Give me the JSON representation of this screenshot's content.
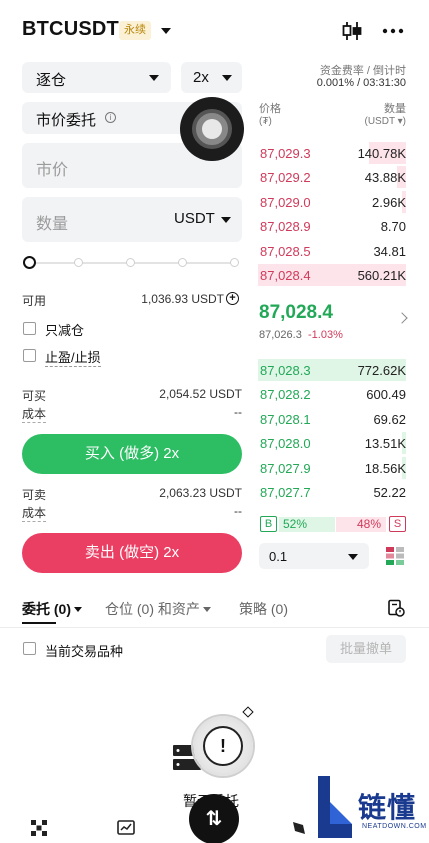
{
  "header": {
    "symbol": "BTCUSDT",
    "badge": "永续"
  },
  "form": {
    "margin_mode": "逐仓",
    "leverage": "2x",
    "order_type": "市价委托",
    "info_glyph": "i",
    "price_placeholder": "市价",
    "qty_placeholder": "数量",
    "qty_unit": "USDT",
    "available_label": "可用",
    "available_value": "1,036.93 USDT",
    "plus_glyph": "+",
    "reduce_only": "只减仓",
    "tp_sl": "止盈/止损",
    "can_buy_label": "可买",
    "can_buy_value": "2,054.52 USDT",
    "cost_label": "成本",
    "cost_value": "--",
    "buy_button": "买入 (做多) 2x",
    "can_sell_label": "可卖",
    "can_sell_value": "2,063.23 USDT",
    "cost2_label": "成本",
    "cost2_value": "--",
    "sell_button": "卖出 (做空) 2x",
    "slider_value_percent": 0
  },
  "orderbook": {
    "funding_label": "资金费率 / 倒计时",
    "funding_value": "0.001% / 03:31:30",
    "price_header": "价格",
    "price_unit": "(₮)",
    "qty_header": "数量",
    "qty_unit": "(USDT ▾)",
    "asks": [
      {
        "price": "87,029.3",
        "qty": "140.78K",
        "depth": 0.25
      },
      {
        "price": "87,029.2",
        "qty": "43.88K",
        "depth": 0.06
      },
      {
        "price": "87,029.0",
        "qty": "2.96K",
        "depth": 0.02
      },
      {
        "price": "87,028.9",
        "qty": "8.70",
        "depth": 0.0
      },
      {
        "price": "87,028.5",
        "qty": "34.81",
        "depth": 0.0
      },
      {
        "price": "87,028.4",
        "qty": "560.21K",
        "depth": 1.0
      }
    ],
    "last_price": "87,028.4",
    "mark_price": "87,026.3",
    "change_pct": "-1.03%",
    "bids": [
      {
        "price": "87,028.3",
        "qty": "772.62K",
        "depth": 1.0
      },
      {
        "price": "87,028.2",
        "qty": "600.49",
        "depth": 0.0
      },
      {
        "price": "87,028.1",
        "qty": "69.62",
        "depth": 0.0
      },
      {
        "price": "87,028.0",
        "qty": "13.51K",
        "depth": 0.02
      },
      {
        "price": "87,027.9",
        "qty": "18.56K",
        "depth": 0.02
      },
      {
        "price": "87,027.7",
        "qty": "52.22",
        "depth": 0.0
      }
    ],
    "buy_letter": "B",
    "sell_letter": "S",
    "buy_ratio": "52%",
    "sell_ratio": "48%",
    "depth_precision": "0.1"
  },
  "tabs": {
    "orders": "委托 (0)",
    "positions": "仓位 (0) 和资产",
    "strategy": "策略 (0)"
  },
  "orders_panel": {
    "current_symbol_only": "当前交易品种",
    "cancel_all": "批量撤单",
    "empty_text": "暂无委托",
    "warn_glyph": "!"
  },
  "bottom_nav": {
    "swap_glyph": "⇅"
  },
  "watermark": {
    "brand": "链懂",
    "domain": "NEATDOWN.COM"
  },
  "colors": {
    "buy": "#2dbd63",
    "sell": "#ea3f63",
    "ask_text": "#d03a5a",
    "bid_text": "#22a857"
  }
}
